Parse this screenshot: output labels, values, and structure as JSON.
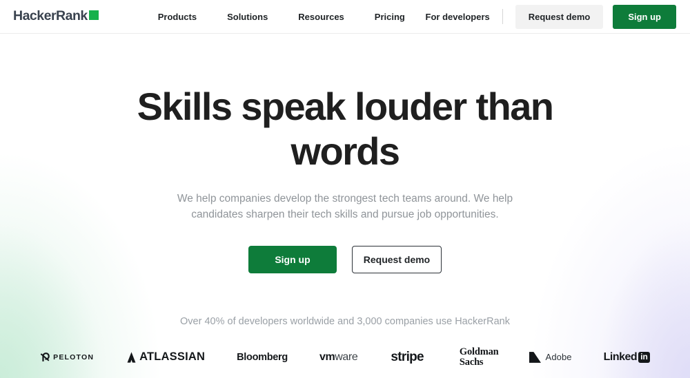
{
  "brand": {
    "name": "HackerRank",
    "logo_square_color": "#16b14b",
    "accent_green": "#0e7c3a"
  },
  "header": {
    "nav_items": [
      {
        "label": "Products"
      },
      {
        "label": "Solutions"
      },
      {
        "label": "Resources"
      },
      {
        "label": "Pricing"
      }
    ],
    "for_developers_label": "For developers",
    "request_demo_label": "Request demo",
    "sign_up_label": "Sign up"
  },
  "hero": {
    "headline": "Skills speak louder than words",
    "subheadline": "We help companies develop the strongest tech teams around. We help candidates sharpen their tech skills and pursue job opportunities.",
    "primary_cta": "Sign up",
    "secondary_cta": "Request demo",
    "proof_text": "Over 40% of developers worldwide and 3,000 companies use HackerRank"
  },
  "logos": [
    {
      "name": "Peloton",
      "text": "PELOTON"
    },
    {
      "name": "Atlassian",
      "text": "ATLASSIAN"
    },
    {
      "name": "Bloomberg",
      "text": "Bloomberg"
    },
    {
      "name": "VMware",
      "text_bold": "vm",
      "text_light": "ware"
    },
    {
      "name": "Stripe",
      "text": "stripe"
    },
    {
      "name": "Goldman Sachs",
      "line1": "Goldman",
      "line2": "Sachs"
    },
    {
      "name": "Adobe",
      "text": "Adobe"
    },
    {
      "name": "LinkedIn",
      "text": "Linked",
      "badge": "in"
    }
  ]
}
